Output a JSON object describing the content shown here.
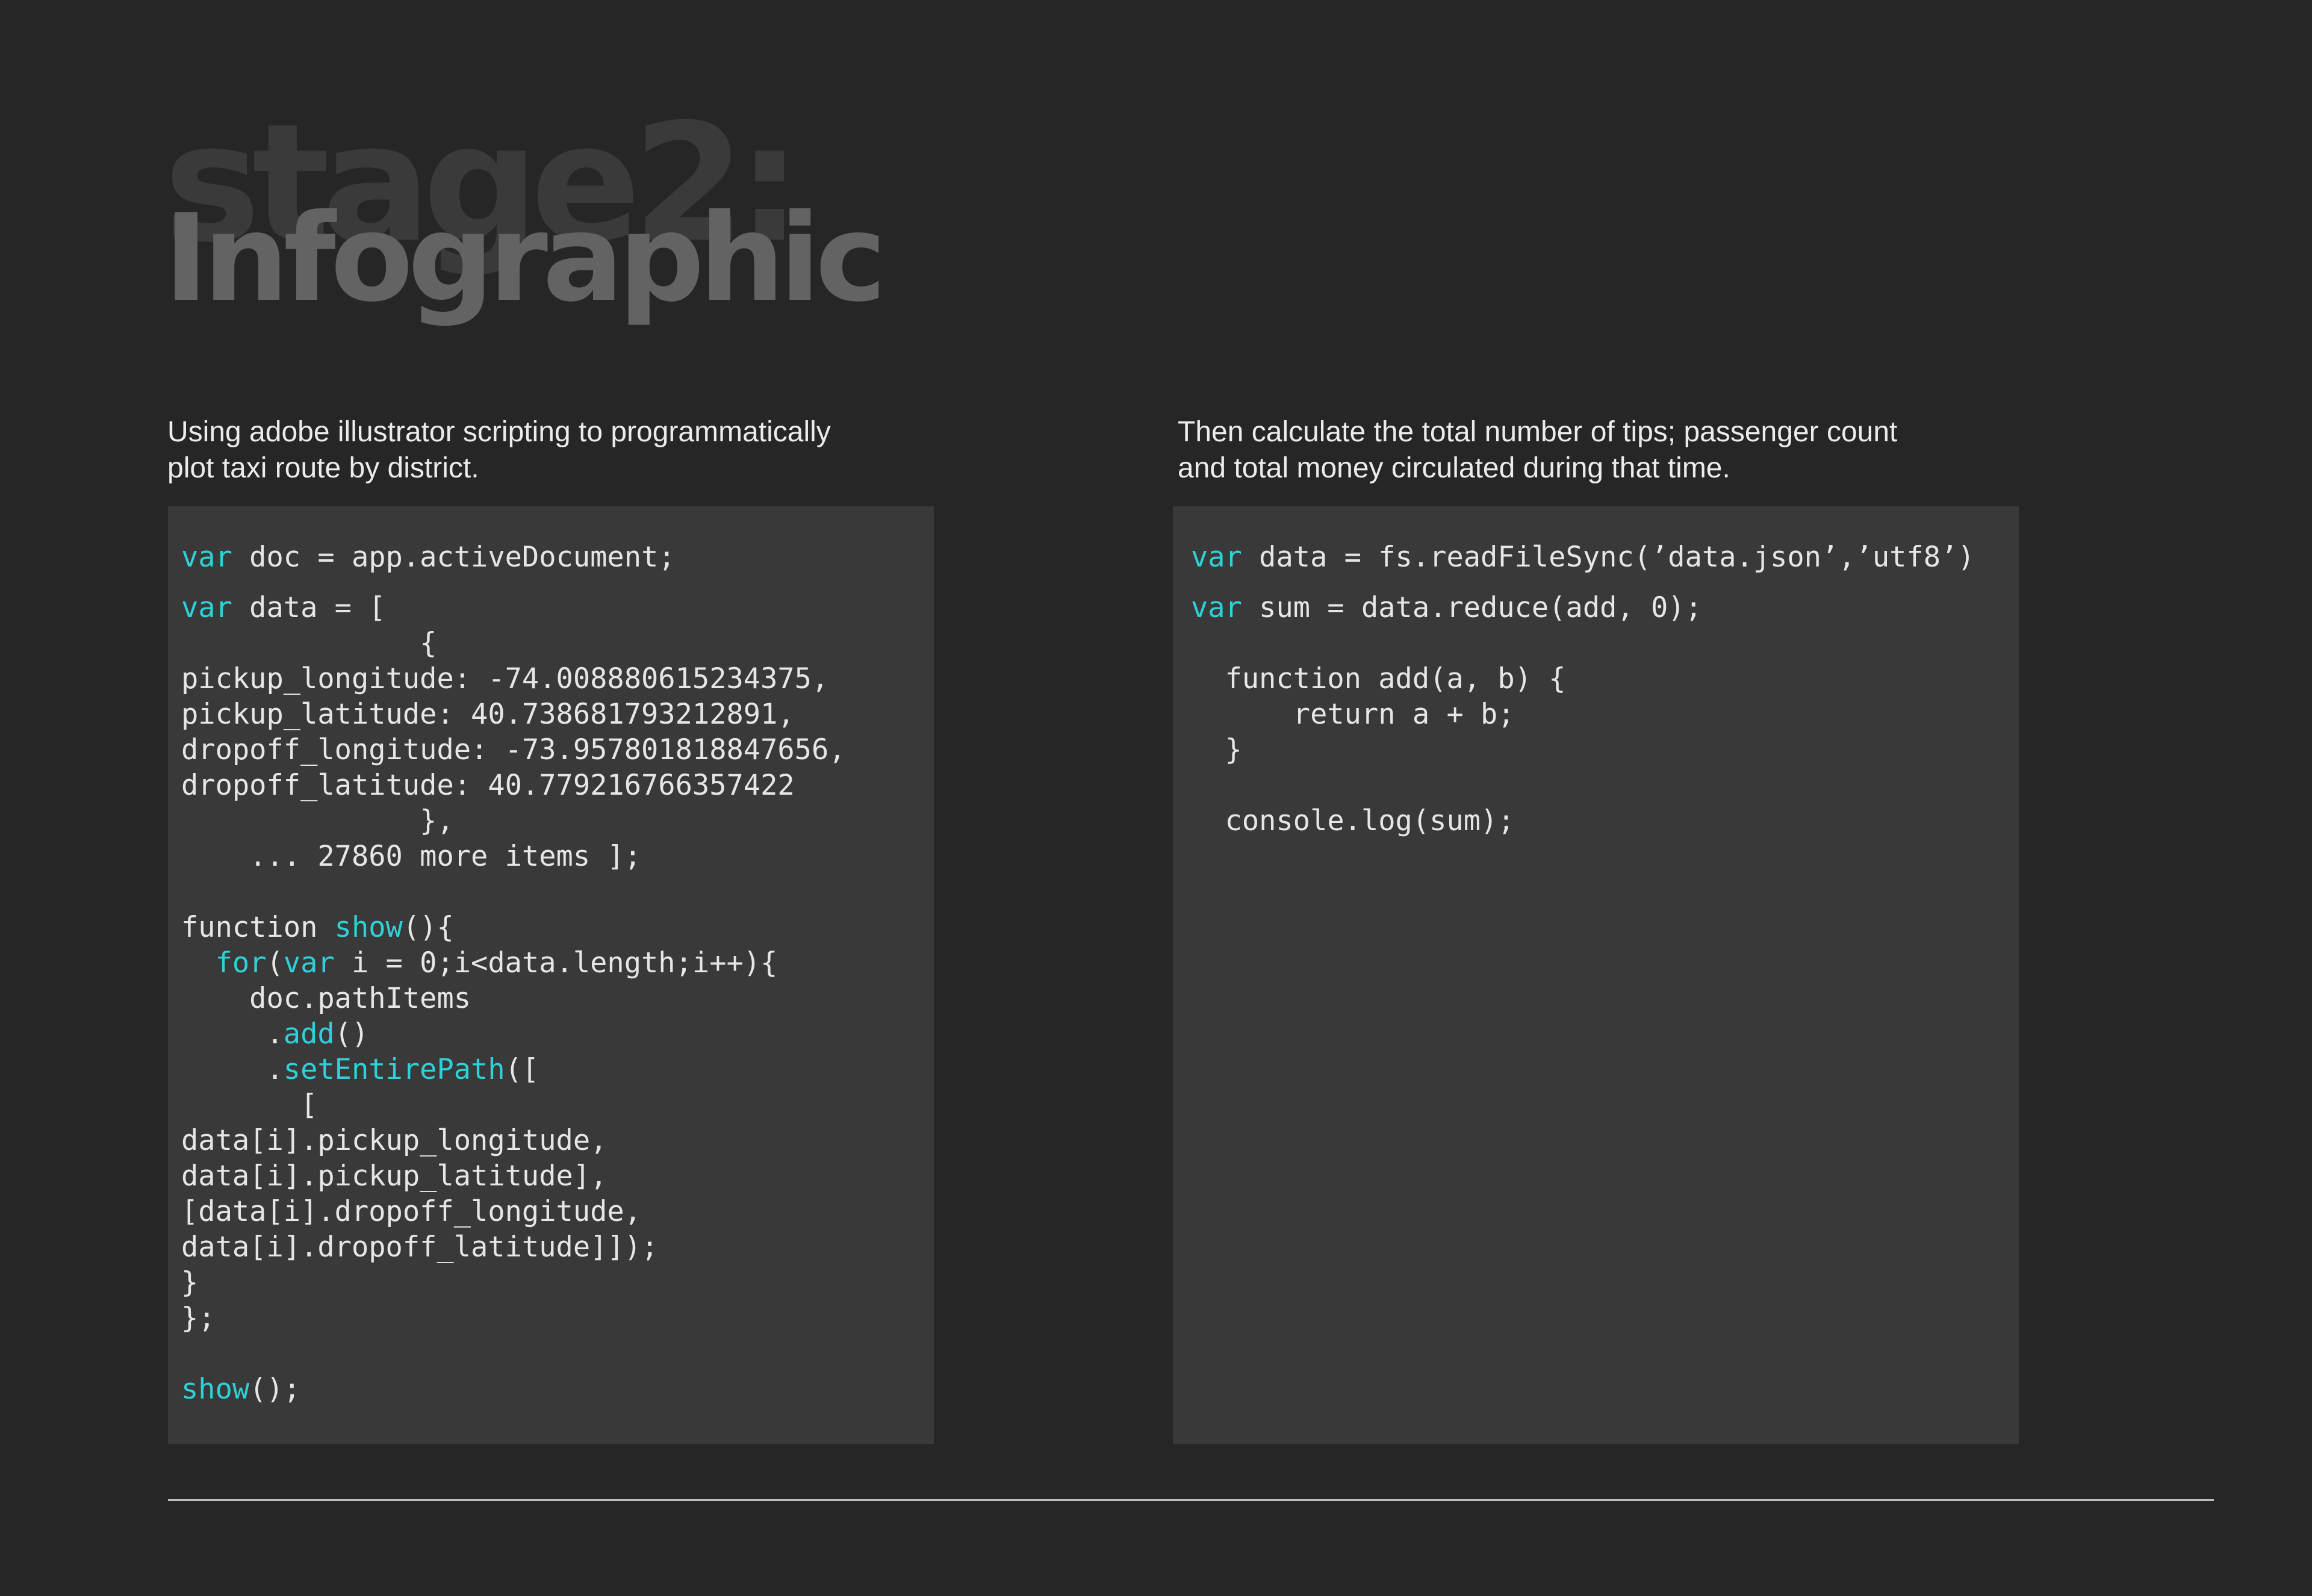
{
  "title": {
    "back": "stage2:",
    "front": "Infographic"
  },
  "left": {
    "caption": "Using adobe illustrator scripting to programmatically\nplot taxi route by district.",
    "code": [
      [
        {
          "k": true,
          "t": "var"
        },
        {
          "t": " doc = app.activeDocument;"
        }
      ],
      [
        {
          "k": true,
          "t": "var"
        },
        {
          "t": " data = ["
        }
      ],
      [
        {
          "t": "              {"
        }
      ],
      [
        {
          "t": "pickup_longitude: -74.008880615234375,"
        }
      ],
      [
        {
          "t": "pickup_latitude: 40.738681793212891,"
        }
      ],
      [
        {
          "t": "dropoff_longitude: -73.957801818847656,"
        }
      ],
      [
        {
          "t": "dropoff_latitude: 40.779216766357422"
        }
      ],
      [
        {
          "t": "              },"
        }
      ],
      [
        {
          "t": "    ... 27860 more items ];"
        }
      ],
      [
        {
          "t": ""
        }
      ],
      [
        {
          "t": "function "
        },
        {
          "k": true,
          "t": "show"
        },
        {
          "t": "(){"
        }
      ],
      [
        {
          "t": "  "
        },
        {
          "k": true,
          "t": "for"
        },
        {
          "t": "("
        },
        {
          "k": true,
          "t": "var"
        },
        {
          "t": " i = 0;i<data.length;i++){"
        }
      ],
      [
        {
          "t": "    doc.pathItems"
        }
      ],
      [
        {
          "t": "     ."
        },
        {
          "k": true,
          "t": "add"
        },
        {
          "t": "()"
        }
      ],
      [
        {
          "t": "     ."
        },
        {
          "k": true,
          "t": "setEntirePath"
        },
        {
          "t": "(["
        }
      ],
      [
        {
          "t": "       ["
        }
      ],
      [
        {
          "t": "data[i].pickup_longitude,"
        }
      ],
      [
        {
          "t": "data[i].pickup_latitude],"
        }
      ],
      [
        {
          "t": "[data[i].dropoff_longitude,"
        }
      ],
      [
        {
          "t": "data[i].dropoff_latitude]]);"
        }
      ],
      [
        {
          "t": "}"
        }
      ],
      [
        {
          "t": "};"
        }
      ],
      [
        {
          "t": ""
        }
      ],
      [
        {
          "k": true,
          "t": "show"
        },
        {
          "t": "();"
        }
      ]
    ]
  },
  "right": {
    "caption": "Then calculate the total number of tips; passenger count\nand total money circulated during that time.",
    "code": [
      [
        {
          "k": true,
          "t": "var"
        },
        {
          "t": " data = fs.readFileSync(’data.json’,’utf8’)"
        }
      ],
      [
        {
          "k": true,
          "t": "var"
        },
        {
          "t": " sum = data.reduce(add, 0);"
        }
      ],
      [
        {
          "t": ""
        }
      ],
      [
        {
          "t": "  function add(a, b) {"
        }
      ],
      [
        {
          "t": "      return a + b;"
        }
      ],
      [
        {
          "t": "  }"
        }
      ],
      [
        {
          "t": ""
        }
      ],
      [
        {
          "t": "  console.log(sum);"
        }
      ]
    ]
  },
  "colors": {
    "background": "#262626",
    "panel": "#393939",
    "keyword": "#2fd1d8",
    "code_text": "#e6e6e6",
    "title_back": "#3a3a3a",
    "title_front": "#636363"
  }
}
